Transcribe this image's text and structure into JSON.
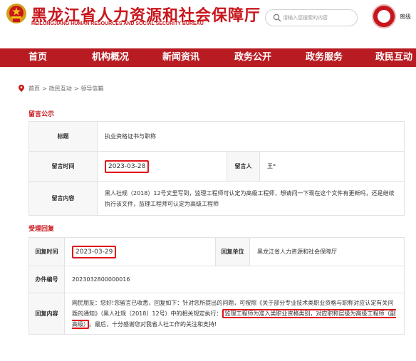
{
  "header": {
    "title": "黑龙江省人力资源和社会保障厅",
    "subtitle": "HEILONGJIANG HUMAN RESOURCES AND SOCIAL SECURITY BUREAU",
    "search_placeholder": "请输入您搜索的内容",
    "badge_text": "离级",
    "brand_color": "#c8161d"
  },
  "nav": {
    "items": [
      "首页",
      "机构概况",
      "新闻资讯",
      "政务公开",
      "政务服务",
      "政民互动"
    ],
    "background": "#b81c22"
  },
  "breadcrumb": {
    "items": [
      "首页",
      ">",
      "政民互动",
      ">",
      "领导信箱"
    ]
  },
  "message": {
    "section_title": "留言公示",
    "title_label": "标题",
    "title_value": "执业资格证书与职称",
    "time_label": "留言时间",
    "time_value": "2023-03-28",
    "author_label": "留言人",
    "author_value": "王*",
    "content_label": "留言内容",
    "content_value": "黑人社规（2018）12号文里写到，监理工程师可认定为高级工程师，想请问一下现在这个文件有更新吗，还是继续执行该文件，监理工程师可认定为高级工程师"
  },
  "reply": {
    "section_title": "受理回复",
    "time_label": "回复时间",
    "time_value": "2023-03-29",
    "unit_label": "回复单位",
    "unit_value": "黑龙江省人力资源和社会保障厅",
    "number_label": "办件编号",
    "number_value": "2023032800000016",
    "content_label": "回复内容",
    "content_part1": "网民朋友：您好!您留言已收悉，回复如下：针对您所提出的问题，可按照《关于部分专业技术类职业资格与职称对应认定有关问题的通知》（黑人社规〔2018〕12号）中的相关规定执行：",
    "content_highlight1": "监理工程师为准入类职业资格类别，对应职称层级为高级工程师（副高级）",
    "content_part2": "。最后，十分感谢您对我省人社工作的关注和支持!"
  }
}
